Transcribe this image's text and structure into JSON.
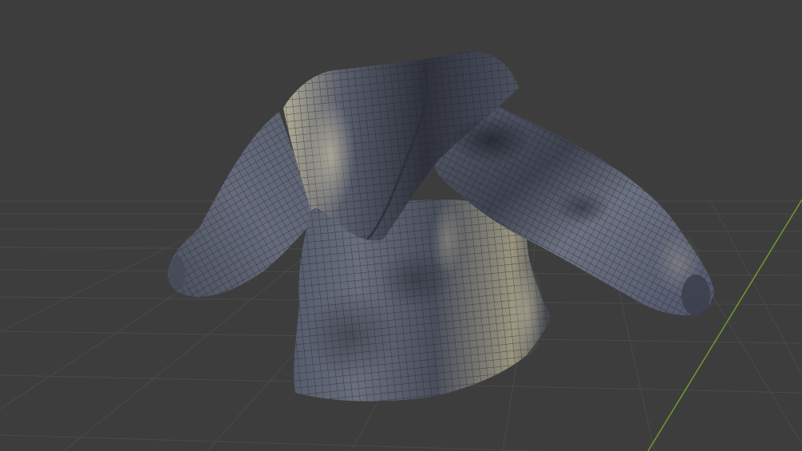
{
  "viewport": {
    "background": "#3d3d3d",
    "grid_line_color": "#4b4b4b",
    "grid_highlight_color": "#555555",
    "y_axis_color": "#6f9a2e"
  },
  "object": {
    "type": "hoodie",
    "shading": "solid-with-wireframe",
    "base_color": "#5b6070",
    "highlight_color": "#b9b29b",
    "shadow_color": "#2f323c",
    "wire_color": "#22242b"
  }
}
